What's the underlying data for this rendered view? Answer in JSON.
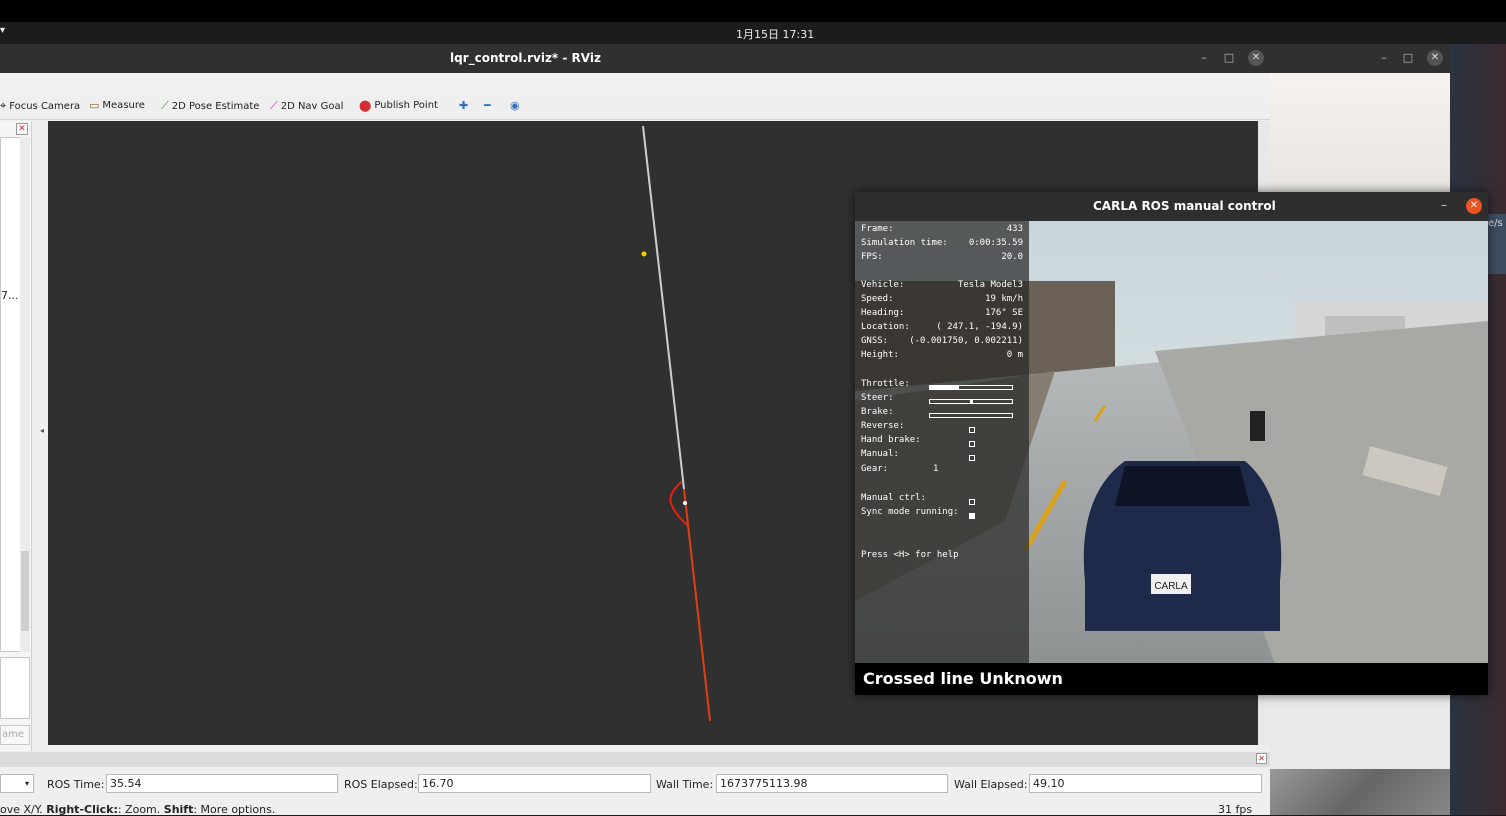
{
  "top_bar": {
    "clock": "1月15日 17:31"
  },
  "rviz": {
    "title": "lqr_control.rviz* - RViz",
    "toolbar": {
      "focus_camera": "Focus Camera",
      "measure": "Measure",
      "pose_estimate": "2D Pose Estimate",
      "nav_goal": "2D Nav Goal",
      "publish_point": "Publish Point"
    },
    "left_panel": {
      "ellipsis": "7...",
      "name_button": "ame"
    },
    "time_panel": {
      "ros_time_label": "ROS Time:",
      "ros_time": "35.54",
      "ros_elapsed_label": "ROS Elapsed:",
      "ros_elapsed": "16.70",
      "wall_time_label": "Wall Time:",
      "wall_time": "1673775113.98",
      "wall_elapsed_label": "Wall Elapsed:",
      "wall_elapsed": "49.10"
    },
    "status": {
      "hint_prefix": "ove X/Y. ",
      "hint_right_click": "Right-Click:",
      "hint_zoom": ": Zoom. ",
      "hint_shift": "Shift",
      "hint_more": ": More options.",
      "fps": "31 fps"
    },
    "colors": {
      "path_gray": "#cfcfcf",
      "path_red": "#e04010",
      "goal_yellow": "#f0d000"
    }
  },
  "other_window": {
    "fragment": "e/s"
  },
  "carla": {
    "title": "CARLA ROS manual control",
    "hud": {
      "frame_label": "Frame:",
      "frame": "433",
      "sim_time_label": "Simulation time:",
      "sim_time": "0:00:35.59",
      "fps_label": "FPS:",
      "fps": "20.0",
      "vehicle_label": "Vehicle:",
      "vehicle": "Tesla Model3",
      "speed_label": "Speed:",
      "speed": "19 km/h",
      "heading_label": "Heading:",
      "heading": "176° SE",
      "location_label": "Location:",
      "location": "( 247.1, -194.9)",
      "gnss_label": "GNSS:",
      "gnss": "(-0.001750,  0.002211)",
      "height_label": "Height:",
      "height": "0 m",
      "throttle_label": "Throttle:",
      "throttle": 0.35,
      "steer_label": "Steer:",
      "steer": 0.0,
      "brake_label": "Brake:",
      "brake": 0.0,
      "reverse_label": "Reverse:",
      "hand_brake_label": "Hand brake:",
      "manual_label": "Manual:",
      "gear_label": "Gear:",
      "gear": "1",
      "manual_ctrl_label": "Manual ctrl:",
      "sync_mode_label": "Sync mode running:",
      "help": "Press <H> for help"
    },
    "plate": "CARLA",
    "notice": "Crossed line Unknown"
  }
}
